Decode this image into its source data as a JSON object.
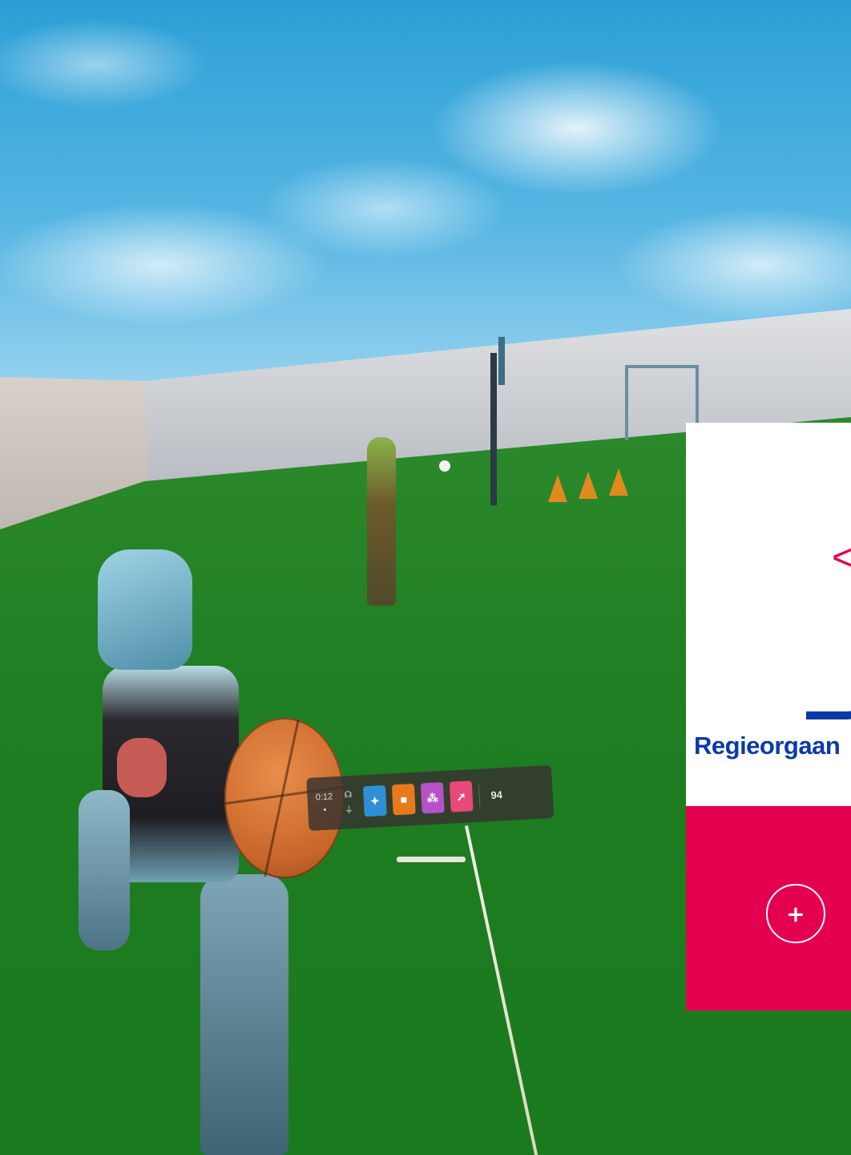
{
  "game_hud": {
    "menu_bar": {
      "left_label": "0:12",
      "icons": [
        {
          "name": "settings-icon",
          "glyph": "✦",
          "color": "#2f8fd6"
        },
        {
          "name": "bag-icon",
          "glyph": "■",
          "color": "#e87a1c"
        },
        {
          "name": "people-icon",
          "glyph": "⁂",
          "color": "#b552c8"
        },
        {
          "name": "share-icon",
          "glyph": "➚",
          "color": "#e8487a"
        }
      ],
      "score": "94"
    }
  },
  "overlay_card": {
    "logo_text": "Regieorgaan",
    "logo_mark": "<",
    "plus_glyph": "+",
    "colors": {
      "brand_blue": "#0b3aa8",
      "brand_pink": "#e4004f",
      "card_bg": "#ffffff"
    }
  }
}
